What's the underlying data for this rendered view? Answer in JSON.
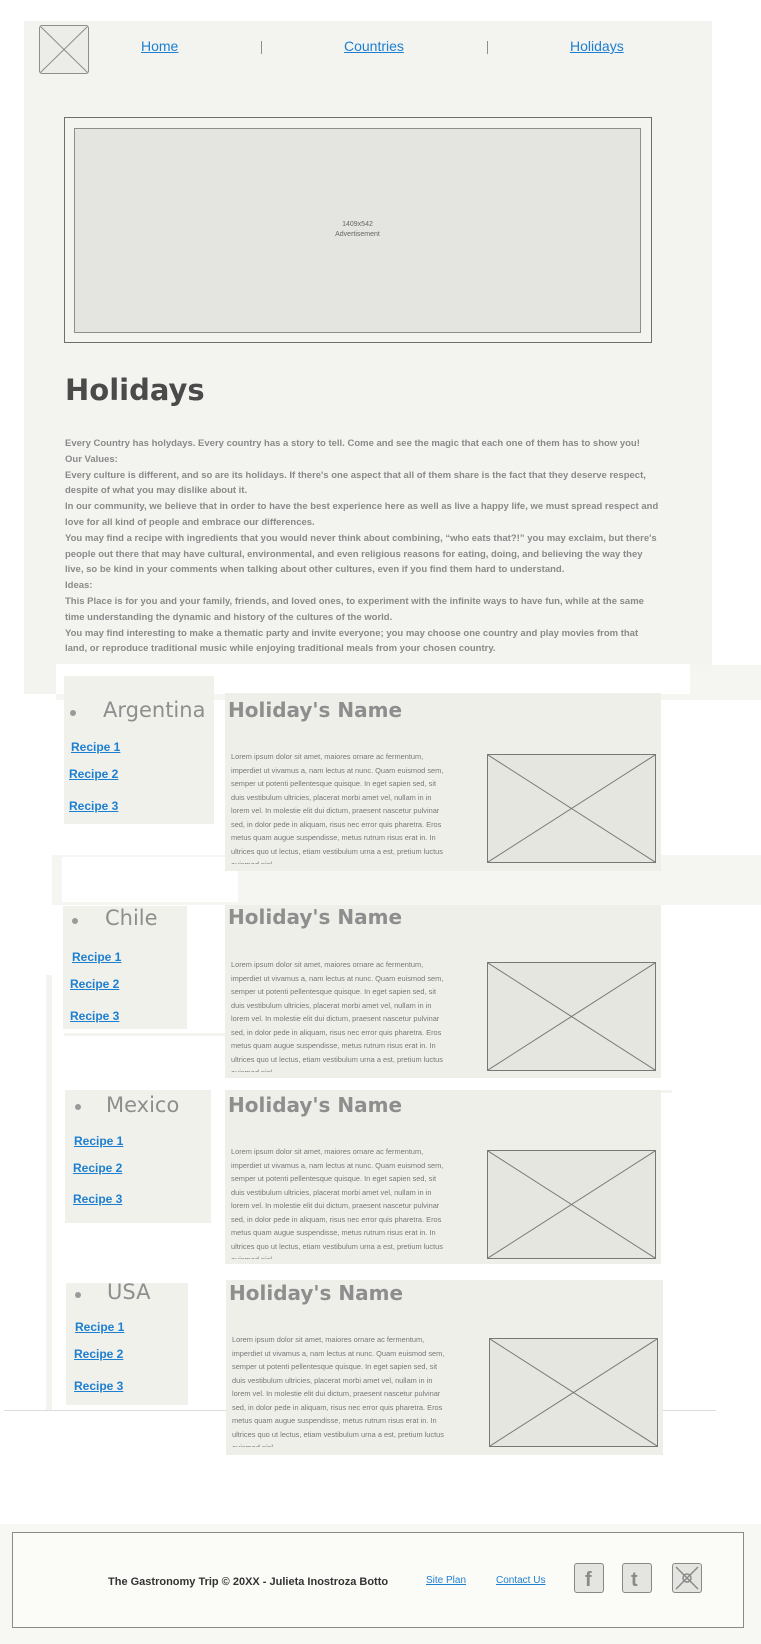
{
  "nav": {
    "home": "Home",
    "countries": "Countries",
    "holidays": "Holidays"
  },
  "ad": {
    "size": "1409x542",
    "label": "Advertisement"
  },
  "page_title": "Holidays",
  "intro": [
    "Every Country has holydays. Every country has a story to tell. Come and see the magic that each one of them has to show you!",
    "Our Values:",
    "Every culture is different, and so are its holidays. If there's one aspect that all of them share is the fact that they deserve respect, despite of what you may dislike about it.",
    "In our community, we believe that in order to have the best experience here as well as live a happy life, we must spread respect and love for all kind of people and embrace our differences.",
    "You may find a recipe with ingredients that you would never think about combining, “who eats that?!” you may exclaim, but there's people out there that may have cultural, environmental, and even religious reasons for eating, doing, and believing the way they live, so be kind in your comments when talking about other cultures, even if you find them hard to understand.",
    "Ideas:",
    "This Place is for you and your family, friends, and loved ones, to experiment with the infinite ways to have fun, while at the same time understanding the dynamic and history of the cultures of the world.",
    "You may find interesting to make a thematic party and invite everyone; you may choose one country and play movies from that land, or reproduce traditional music while enjoying traditional meals from your chosen country."
  ],
  "countries": [
    {
      "name": "Argentina",
      "recipes": [
        "Recipe 1",
        "Recipe 2",
        "Recipe 3"
      ],
      "holiday_name": "Holiday's Name",
      "lorem": "Lorem ipsum dolor sit amet, maiores ornare ac fermentum, imperdiet ut vivamus a, nam lectus at nunc. Quam euismod sem, semper ut potenti pellentesque quisque. In eget sapien sed, sit duis vestibulum ultricies, placerat morbi amet vel, nullam in in lorem vel. In molestie elit dui dictum, praesent nascetur pulvinar sed, in dolor pede in aliquam, risus nec error quis pharetra. Eros metus quam augue suspendisse, metus rutrum risus erat in. In ultrices quo ut lectus, etiam vestibulum urna a est, pretium luctus euismod nisl."
    },
    {
      "name": "Chile",
      "recipes": [
        "Recipe 1",
        "Recipe 2",
        "Recipe 3"
      ],
      "holiday_name": "Holiday's Name",
      "lorem": "Lorem ipsum dolor sit amet, maiores ornare ac fermentum, imperdiet ut vivamus a, nam lectus at nunc. Quam euismod sem, semper ut potenti pellentesque quisque. In eget sapien sed, sit duis vestibulum ultricies, placerat morbi amet vel, nullam in in lorem vel. In molestie elit dui dictum, praesent nascetur pulvinar sed, in dolor pede in aliquam, risus nec error quis pharetra. Eros metus quam augue suspendisse, metus rutrum risus erat in. In ultrices quo ut lectus, etiam vestibulum urna a est, pretium luctus euismod nisl."
    },
    {
      "name": "Mexico",
      "recipes": [
        "Recipe 1",
        "Recipe 2",
        "Recipe 3"
      ],
      "holiday_name": "Holiday's Name",
      "lorem": "Lorem ipsum dolor sit amet, maiores ornare ac fermentum, imperdiet ut vivamus a, nam lectus at nunc. Quam euismod sem, semper ut potenti pellentesque quisque. In eget sapien sed, sit duis vestibulum ultricies, placerat morbi amet vel, nullam in in lorem vel. In molestie elit dui dictum, praesent nascetur pulvinar sed, in dolor pede in aliquam, risus nec error quis pharetra. Eros metus quam augue suspendisse, metus rutrum risus erat in. In ultrices quo ut lectus, etiam vestibulum urna a est, pretium luctus euismod nisl."
    },
    {
      "name": "USA",
      "recipes": [
        "Recipe 1",
        "Recipe 2",
        "Recipe 3"
      ],
      "holiday_name": "Holiday's Name",
      "lorem": "Lorem ipsum dolor sit amet, maiores ornare ac fermentum, imperdiet ut vivamus a, nam lectus at nunc. Quam euismod sem, semper ut potenti pellentesque quisque. In eget sapien sed, sit duis vestibulum ultricies, placerat morbi amet vel, nullam in in lorem vel. In molestie elit dui dictum, praesent nascetur pulvinar sed, in dolor pede in aliquam, risus nec error quis pharetra. Eros metus quam augue suspendisse, metus rutrum risus erat in. In ultrices quo ut lectus, etiam vestibulum urna a est, pretium luctus euismod nisl."
    }
  ],
  "footer": {
    "copyright": "The Gastronomy Trip © 20XX - Julieta Inostroza Botto",
    "site_plan": "Site Plan",
    "contact_us": "Contact Us"
  },
  "icons": {
    "logo": "logo-placeholder-icon",
    "facebook": "facebook-icon",
    "twitter": "twitter-icon",
    "other": "image-placeholder-icon"
  }
}
